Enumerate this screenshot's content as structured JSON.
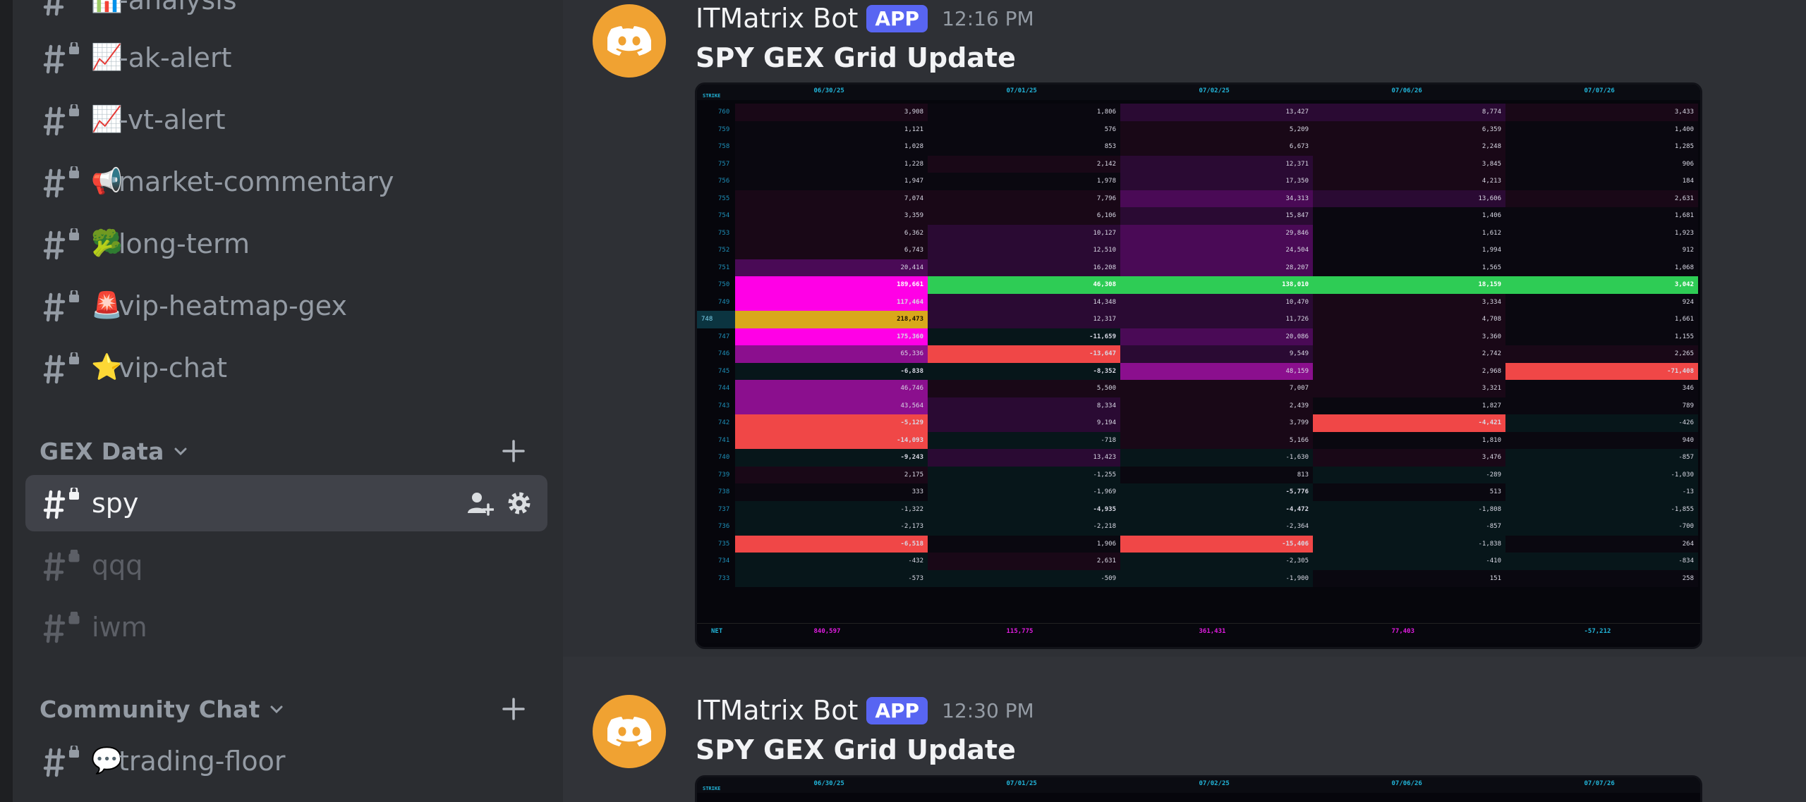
{
  "sidebar": {
    "channels": [
      {
        "emoji": "📊",
        "label": "-analysis"
      },
      {
        "emoji": "📈",
        "label": "-ak-alert"
      },
      {
        "emoji": "📈",
        "label": "-vt-alert"
      },
      {
        "emoji": "📢",
        "label": "market-commentary"
      },
      {
        "emoji": "🥦",
        "label": "long-term"
      },
      {
        "emoji": "🚨",
        "label": "vip-heatmap-gex"
      },
      {
        "emoji": "⭐",
        "label": "vip-chat"
      }
    ],
    "gex_category": "GEX Data",
    "gex_channels": [
      {
        "label": "spy"
      },
      {
        "label": "qqq"
      },
      {
        "label": "iwm"
      }
    ],
    "community_category": "Community Chat",
    "community_channels": [
      {
        "emoji": "💬",
        "label": "trading-floor"
      }
    ]
  },
  "messages": [
    {
      "username": "ITMatrix Bot",
      "badge": "APP",
      "time": "12:16 PM",
      "title": "SPY GEX Grid Update"
    },
    {
      "username": "ITMatrix Bot",
      "badge": "APP",
      "time": "12:30 PM",
      "title": "SPY GEX Grid Update"
    }
  ],
  "grid": {
    "strike_header": "STRIKE",
    "dates": [
      "06/30/25",
      "07/01/25",
      "07/02/25",
      "07/06/26",
      "07/07/26"
    ],
    "rows": [
      {
        "strike": "760",
        "values": [
          "3,908",
          "1,806",
          "13,427",
          "8,774",
          "3,433"
        ]
      },
      {
        "strike": "759",
        "values": [
          "1,121",
          "576",
          "5,209",
          "6,359",
          "1,400"
        ]
      },
      {
        "strike": "758",
        "values": [
          "1,028",
          "853",
          "6,673",
          "2,248",
          "1,285"
        ]
      },
      {
        "strike": "757",
        "values": [
          "1,228",
          "2,142",
          "12,371",
          "3,845",
          "906"
        ]
      },
      {
        "strike": "756",
        "values": [
          "1,947",
          "1,978",
          "17,350",
          "4,213",
          "184"
        ]
      },
      {
        "strike": "755",
        "values": [
          "7,074",
          "7,796",
          "34,313",
          "13,606",
          "2,631"
        ]
      },
      {
        "strike": "754",
        "values": [
          "3,359",
          "6,106",
          "15,847",
          "1,406",
          "1,681"
        ]
      },
      {
        "strike": "753",
        "values": [
          "6,362",
          "10,127",
          "29,846",
          "1,612",
          "1,923"
        ]
      },
      {
        "strike": "752",
        "values": [
          "6,743",
          "12,510",
          "24,504",
          "1,994",
          "912"
        ]
      },
      {
        "strike": "751",
        "values": [
          "20,414",
          "16,208",
          "28,207",
          "1,565",
          "1,068"
        ]
      },
      {
        "strike": "750",
        "values": [
          "189,661",
          "46,308",
          "138,010",
          "18,159",
          "3,042"
        ]
      },
      {
        "strike": "749",
        "values": [
          "117,464",
          "14,348",
          "10,470",
          "3,334",
          "924"
        ]
      },
      {
        "strike": "748",
        "values": [
          "218,473",
          "12,317",
          "11,726",
          "4,708",
          "1,661"
        ]
      },
      {
        "strike": "747",
        "values": [
          "175,360",
          "-11,659",
          "20,086",
          "3,360",
          "1,155"
        ]
      },
      {
        "strike": "746",
        "values": [
          "65,336",
          "-13,647",
          "9,549",
          "2,742",
          "2,265"
        ]
      },
      {
        "strike": "745",
        "values": [
          "-6,838",
          "-8,352",
          "48,159",
          "2,968",
          "-71,408"
        ]
      },
      {
        "strike": "744",
        "values": [
          "46,746",
          "5,500",
          "7,007",
          "3,321",
          "346"
        ]
      },
      {
        "strike": "743",
        "values": [
          "43,564",
          "8,334",
          "2,439",
          "1,827",
          "789"
        ]
      },
      {
        "strike": "742",
        "values": [
          "-5,129",
          "9,194",
          "3,799",
          "-4,421",
          "-426"
        ]
      },
      {
        "strike": "741",
        "values": [
          "-14,093",
          "-718",
          "5,166",
          "1,810",
          "940"
        ]
      },
      {
        "strike": "740",
        "values": [
          "-9,243",
          "13,423",
          "-1,630",
          "3,476",
          "-857"
        ]
      },
      {
        "strike": "739",
        "values": [
          "2,175",
          "-1,255",
          "813",
          "-289",
          "-1,030"
        ]
      },
      {
        "strike": "738",
        "values": [
          "333",
          "-1,969",
          "-5,776",
          "513",
          "-13"
        ]
      },
      {
        "strike": "737",
        "values": [
          "-1,322",
          "-4,935",
          "-4,472",
          "-1,808",
          "-1,855"
        ]
      },
      {
        "strike": "736",
        "values": [
          "-2,173",
          "-2,218",
          "-2,364",
          "-857",
          "-700"
        ]
      },
      {
        "strike": "735",
        "values": [
          "-6,518",
          "1,906",
          "-15,406",
          "-1,838",
          "264"
        ]
      },
      {
        "strike": "734",
        "values": [
          "-432",
          "2,631",
          "-2,305",
          "-410",
          "-834"
        ]
      },
      {
        "strike": "733",
        "values": [
          "-573",
          "-509",
          "-1,900",
          "151",
          "258"
        ]
      }
    ],
    "net_label": "NET",
    "net_values": [
      "840,597",
      "115,775",
      "361,431",
      "77,403",
      "-57,212"
    ]
  },
  "colors": {
    "magenta": "#ff00e6",
    "gold": "#d9a81b",
    "green": "#2ecc55",
    "red": "#f04747",
    "purple_strong": "#8b0f8e",
    "avatar": "#f0a232",
    "badge": "#5865f2"
  }
}
